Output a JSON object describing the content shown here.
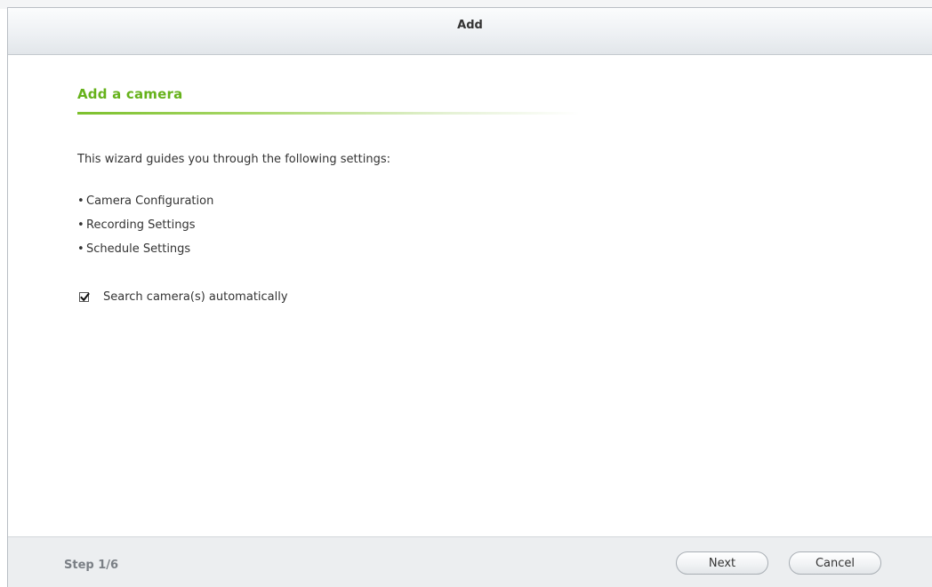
{
  "dialog": {
    "title": "Add"
  },
  "content": {
    "heading": "Add a camera",
    "intro": "This wizard guides you through the following settings:",
    "steps": [
      "Camera Configuration",
      "Recording Settings",
      "Schedule Settings"
    ],
    "bullet": "•",
    "auto_search": {
      "label": "Search camera(s) automatically",
      "checked": true
    }
  },
  "footer": {
    "step_label": "Step 1/6",
    "next_label": "Next",
    "cancel_label": "Cancel"
  },
  "colors": {
    "accent_green": "#66b21b",
    "titlebar": "#eef1f4",
    "footer_bg": "#eceef0"
  }
}
